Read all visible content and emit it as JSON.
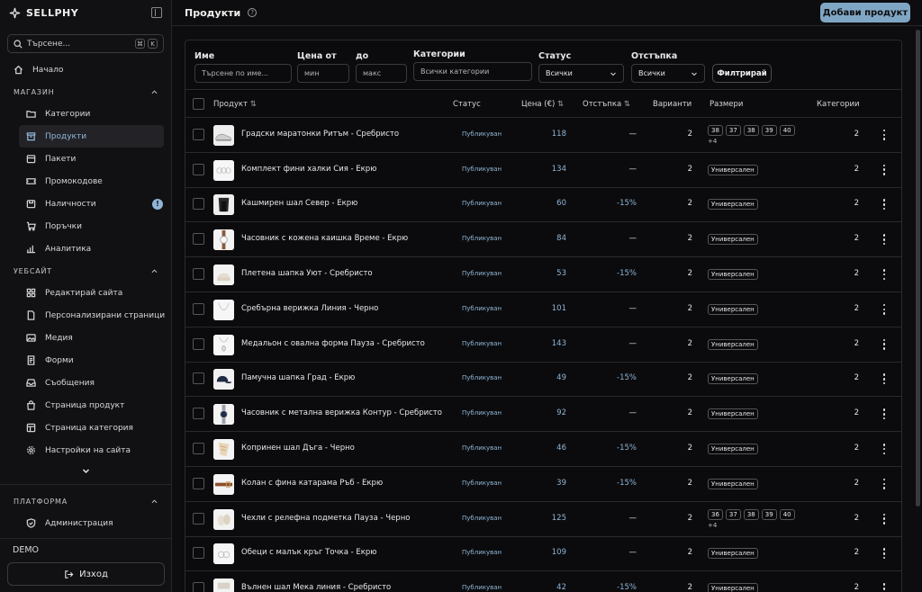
{
  "brand": {
    "name": "SELLPHY"
  },
  "search": {
    "placeholder": "Търсене...",
    "kbd1": "⌘",
    "kbd2": "K"
  },
  "nav": {
    "home": "Начало",
    "store_section": "МАГАЗИН",
    "store_items": [
      "Категории",
      "Продукти",
      "Пакети",
      "Промокодове",
      "Наличности",
      "Поръчки",
      "Аналитика"
    ],
    "inventory_badge": "!",
    "website_section": "УЕБСАЙТ",
    "website_items": [
      "Редактирай сайта",
      "Персонализирани страници",
      "Медия",
      "Форми",
      "Съобщения",
      "Страница продукт",
      "Страница категория",
      "Настройки на сайта"
    ],
    "platform_section": "ПЛАТФОРМА",
    "platform_items": [
      "Администрация"
    ]
  },
  "footer": {
    "demo": "DEMO",
    "logout": "Изход"
  },
  "header": {
    "title": "Продукти",
    "help": "?",
    "add_button": "Добави продукт"
  },
  "filters": {
    "name_label": "Име",
    "name_placeholder": "Търсене по име...",
    "price_from_label": "Цена от",
    "price_from_placeholder": "мин",
    "price_to_label": "до",
    "price_to_placeholder": "макс",
    "categories_label": "Категории",
    "categories_value": "Всички категории",
    "status_label": "Статус",
    "status_value": "Всички",
    "discount_label": "Отстъпка",
    "discount_value": "Всички",
    "filter_button": "Филтрирай"
  },
  "table": {
    "columns": {
      "product": "Продукт",
      "status": "Статус",
      "price": "Цена (€)",
      "discount": "Отстъпка",
      "variants": "Варианти",
      "sizes": "Размери",
      "categories": "Категории"
    },
    "rows": [
      {
        "name": "Градски маратонки Ритъм - Сребристо",
        "status": "Публикуван",
        "price": "118",
        "discount": "—",
        "variants": "2",
        "sizes": [
          "38",
          "37",
          "38",
          "39",
          "40"
        ],
        "more": "+4",
        "categories": "2",
        "thumb": "sneaker"
      },
      {
        "name": "Комплект фини халки Сия - Екрю",
        "status": "Публикуван",
        "price": "134",
        "discount": "—",
        "variants": "2",
        "sizes": [
          "Универсален"
        ],
        "more": "",
        "categories": "2",
        "thumb": "earrings"
      },
      {
        "name": "Кашмирен шал Север - Екрю",
        "status": "Публикуван",
        "price": "60",
        "discount": "-15%",
        "variants": "2",
        "sizes": [
          "Универсален"
        ],
        "more": "",
        "categories": "2",
        "thumb": "scarf-dark"
      },
      {
        "name": "Часовник с кожена каишка Време - Екрю",
        "status": "Публикуван",
        "price": "84",
        "discount": "—",
        "variants": "2",
        "sizes": [
          "Универсален"
        ],
        "more": "",
        "categories": "2",
        "thumb": "watch-brown"
      },
      {
        "name": "Плетена шапка Уют - Сребристо",
        "status": "Публикуван",
        "price": "53",
        "discount": "-15%",
        "variants": "2",
        "sizes": [
          "Универсален"
        ],
        "more": "",
        "categories": "2",
        "thumb": "beanie"
      },
      {
        "name": "Сребърна верижка Линия - Черно",
        "status": "Публикуван",
        "price": "101",
        "discount": "—",
        "variants": "2",
        "sizes": [
          "Универсален"
        ],
        "more": "",
        "categories": "2",
        "thumb": "necklace"
      },
      {
        "name": "Медальон с овална форма Пауза - Сребристо",
        "status": "Публикуван",
        "price": "143",
        "discount": "—",
        "variants": "2",
        "sizes": [
          "Универсален"
        ],
        "more": "",
        "categories": "2",
        "thumb": "pendant"
      },
      {
        "name": "Памучна шапка Град - Екрю",
        "status": "Публикуван",
        "price": "49",
        "discount": "-15%",
        "variants": "2",
        "sizes": [
          "Универсален"
        ],
        "more": "",
        "categories": "2",
        "thumb": "cap"
      },
      {
        "name": "Часовник с метална верижка Контур - Сребристо",
        "status": "Публикуван",
        "price": "92",
        "discount": "—",
        "variants": "2",
        "sizes": [
          "Универсален"
        ],
        "more": "",
        "categories": "2",
        "thumb": "watch-metal"
      },
      {
        "name": "Копринен шал Дъга - Черно",
        "status": "Публикуван",
        "price": "46",
        "discount": "-15%",
        "variants": "2",
        "sizes": [
          "Универсален"
        ],
        "more": "",
        "categories": "2",
        "thumb": "silk-scarf"
      },
      {
        "name": "Колан с фина катарама Ръб - Екрю",
        "status": "Публикуван",
        "price": "39",
        "discount": "-15%",
        "variants": "2",
        "sizes": [
          "Универсален"
        ],
        "more": "",
        "categories": "2",
        "thumb": "belt"
      },
      {
        "name": "Чехли с релефна подметка Пауза - Черно",
        "status": "Публикуван",
        "price": "125",
        "discount": "—",
        "variants": "2",
        "sizes": [
          "36",
          "37",
          "38",
          "39",
          "40"
        ],
        "more": "+4",
        "categories": "2",
        "thumb": "slippers"
      },
      {
        "name": "Обеци с малък кръг Точка - Екрю",
        "status": "Публикуван",
        "price": "109",
        "discount": "—",
        "variants": "2",
        "sizes": [
          "Универсален"
        ],
        "more": "",
        "categories": "2",
        "thumb": "hoops"
      },
      {
        "name": "Вълнен шал Мека линия - Сребристо",
        "status": "Публикуван",
        "price": "42",
        "discount": "-15%",
        "variants": "2",
        "sizes": [
          "Универсален"
        ],
        "more": "",
        "categories": "2",
        "thumb": "wool-scarf"
      }
    ]
  },
  "colors": {
    "accent": "#7fa6c4",
    "link": "#8fb5d6",
    "bg": "#0d0d0f"
  }
}
